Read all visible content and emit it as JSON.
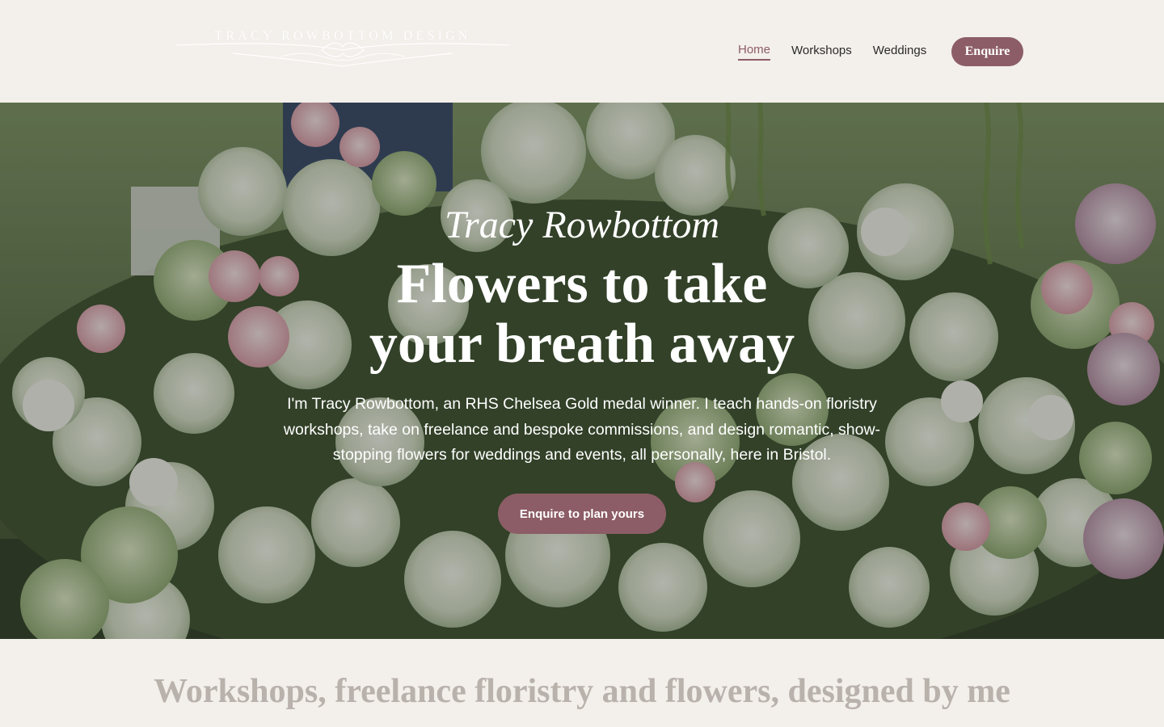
{
  "header": {
    "logo_text": "TRACY ROWBOTTOM DESIGN",
    "nav": [
      {
        "label": "Home",
        "active": true
      },
      {
        "label": "Workshops",
        "active": false
      },
      {
        "label": "Weddings",
        "active": false
      }
    ],
    "enquire_label": "Enquire"
  },
  "hero": {
    "script_name": "Tracy Rowbottom",
    "title_line1": "Flowers to take",
    "title_line2": "your breath away",
    "body": "I'm Tracy Rowbottom, an RHS Chelsea Gold medal winner. I teach hands-on floristry workshops, take on freelance and bespoke commissions, and design romantic, show-stopping flowers for weddings and events, all personally, here in Bristol.",
    "cta_label": "Enquire to plan yours"
  },
  "section": {
    "heading": "Workshops, freelance floristry and flowers, designed by me"
  },
  "colors": {
    "background": "#f3efea",
    "accent": "#8c5d66",
    "heading_muted": "#b9b2ac"
  }
}
